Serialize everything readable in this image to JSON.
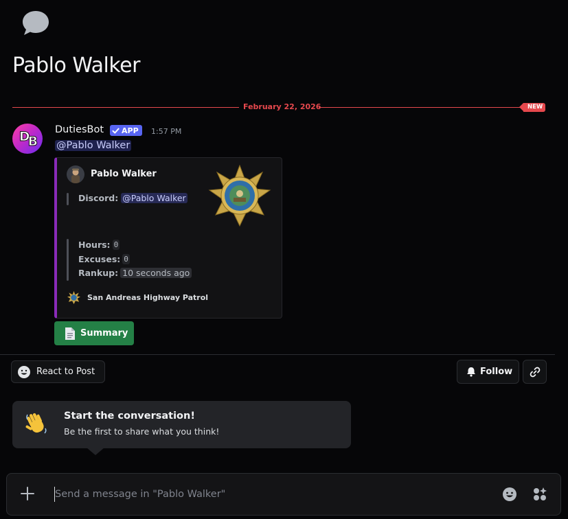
{
  "thread": {
    "title": "Pablo Walker"
  },
  "divider": {
    "date": "February 22, 2026",
    "new_badge": "NEW"
  },
  "message": {
    "author": "DutiesBot",
    "app_badge": "APP",
    "avatar_initials": [
      "D",
      "B"
    ],
    "timestamp": "1:57 PM",
    "mention": "@Pablo Walker",
    "embed": {
      "accent_color": "#8a2bb9",
      "author_name": "Pablo Walker",
      "discord_label": "Discord:",
      "discord_mention": "@Pablo Walker",
      "fields": [
        {
          "label": "Hours:",
          "value": "0"
        },
        {
          "label": "Excuses:",
          "value": "0"
        },
        {
          "label": "Rankup:",
          "value": "10 seconds ago"
        }
      ],
      "thumbnail": "star-badge-icon",
      "footer_text": "San Andreas Highway Patrol"
    },
    "button": {
      "label": "Summary",
      "icon": "document-icon",
      "color": "#248046"
    }
  },
  "actions": {
    "react_label": "React to Post",
    "follow_label": "Follow"
  },
  "tooltip": {
    "emoji": "👋",
    "title": "Start the conversation!",
    "subtitle": "Be the first to share what you think!"
  },
  "composer": {
    "placeholder": "Send a message in \"Pablo Walker\""
  }
}
